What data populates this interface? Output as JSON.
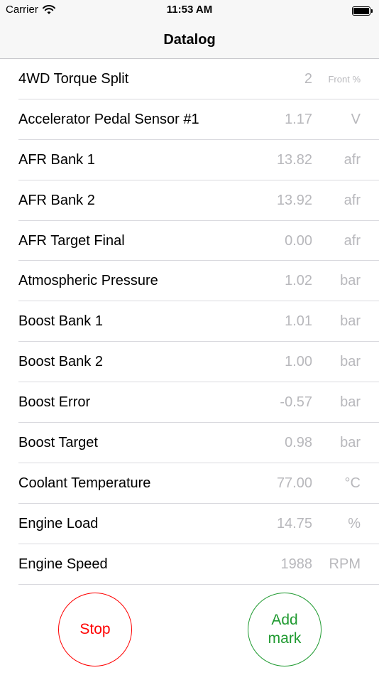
{
  "status_bar": {
    "carrier": "Carrier",
    "time": "11:53 AM"
  },
  "nav": {
    "title": "Datalog"
  },
  "rows": [
    {
      "label": "4WD Torque Split",
      "value": "2",
      "unit": "Front %"
    },
    {
      "label": "Accelerator Pedal Sensor #1",
      "value": "1.17",
      "unit": "V"
    },
    {
      "label": "AFR Bank 1",
      "value": "13.82",
      "unit": "afr"
    },
    {
      "label": "AFR Bank 2",
      "value": "13.92",
      "unit": "afr"
    },
    {
      "label": "AFR Target Final",
      "value": "0.00",
      "unit": "afr"
    },
    {
      "label": "Atmospheric Pressure",
      "value": "1.02",
      "unit": "bar"
    },
    {
      "label": "Boost Bank 1",
      "value": "1.01",
      "unit": "bar"
    },
    {
      "label": "Boost Bank 2",
      "value": "1.00",
      "unit": "bar"
    },
    {
      "label": "Boost Error",
      "value": "-0.57",
      "unit": "bar"
    },
    {
      "label": "Boost Target",
      "value": "0.98",
      "unit": "bar"
    },
    {
      "label": "Coolant Temperature",
      "value": "77.00",
      "unit": "°C"
    },
    {
      "label": "Engine Load",
      "value": "14.75",
      "unit": "%"
    },
    {
      "label": "Engine Speed",
      "value": "1988",
      "unit": "RPM"
    }
  ],
  "buttons": {
    "stop_label": "Stop",
    "mark_label": "Add mark"
  },
  "colors": {
    "stop": "#ff0000",
    "mark": "#1f9a30",
    "value_text": "#b8b8bc"
  },
  "icons": {
    "wifi": "wifi-icon",
    "battery": "battery-icon"
  }
}
